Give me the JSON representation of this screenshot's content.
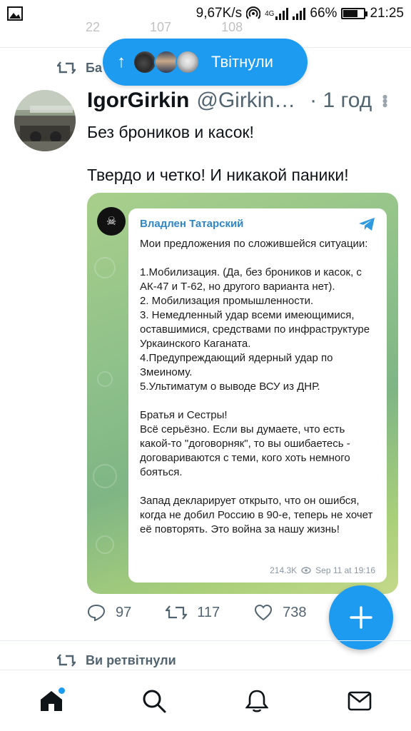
{
  "status_bar": {
    "speed": "9,67K/s",
    "network": "4G",
    "battery_percent": "66%",
    "battery_level": 0.66,
    "time": "21:25"
  },
  "prev_tweet_actions": [
    "22",
    "107",
    "108"
  ],
  "retweet_header_top": {
    "text": "Ба"
  },
  "tweeted_pill": {
    "label": "Твітнули",
    "arrow": "↑"
  },
  "tweet": {
    "display_name": "IgorGirkin",
    "handle": "@Girkin…",
    "time": "· 1 год",
    "text_line1": "Без броников и касок!",
    "text_line2": "Твердо и четко! И никакой паники!",
    "embed": {
      "channel": "Владлен Татарский",
      "paragraph1": "Мои предложения по сложившейся ситуации:",
      "list": [
        "1.Мобилизация. (Да, без броников и касок, с АК-47 и Т-62, но другого варианта нет).",
        "2. Мобилизация промышленности.",
        "3. Немедленный удар всеми имеющимися, оставшимися, средствами по инфраструктуре Уркаинского Каганата.",
        "4.Предупреждающий ядерный удар по Змеиному.",
        "5.Ультиматум о выводе ВСУ из ДНР."
      ],
      "paragraph2": "Братья и Сестры!",
      "paragraph3": "Всё серьёзно. Если вы думаете, что есть какой-то \"договорняк\", то вы ошибаетесь - договариваются с теми, кого хоть немного бояться.",
      "paragraph4": "Запад декларирует открыто, что он ошибся, когда не добил Россию в 90-е, теперь не хочет её повторять. Это война за нашу жизнь!",
      "views": "214.3K",
      "date": "Sep 11 at 19:16"
    },
    "replies": "97",
    "retweets": "117",
    "likes": "738"
  },
  "retweet_header_bottom": {
    "text": "Ви ретвітнули"
  },
  "colors": {
    "accent": "#1d9bf0",
    "muted": "#536471"
  },
  "nav": [
    "home-icon",
    "search-icon",
    "notifications-icon",
    "messages-icon"
  ]
}
